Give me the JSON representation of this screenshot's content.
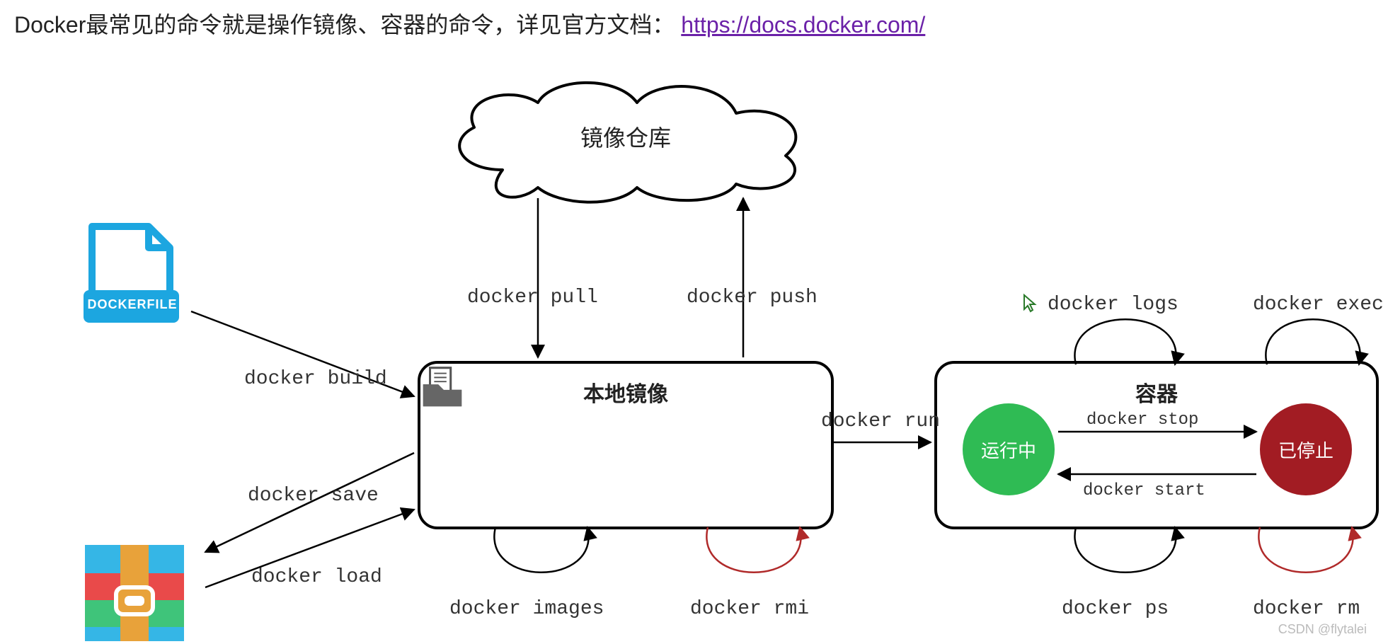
{
  "intro_prefix": "Docker最常见的命令就是操作镜像、容器的命令，详见官方文档：",
  "intro_link": " https://docs.docker.com/",
  "cloud_label": "镜像仓库",
  "local_image_box": "本地镜像",
  "container_box": "容器",
  "dockerfile_label": "DOCKERFILE",
  "running_label": "运行中",
  "stopped_label": "已停止",
  "cmd": {
    "build": "docker build",
    "save": "docker save",
    "load": "docker load",
    "pull": "docker pull",
    "push": "docker push",
    "images": "docker images",
    "rmi": "docker rmi",
    "run": "docker run",
    "logs": "docker logs",
    "exec": "docker exec",
    "ps": "docker ps",
    "rm": "docker rm",
    "stop": "docker stop",
    "start": "docker start"
  },
  "watermark": "CSDN @flytalei"
}
